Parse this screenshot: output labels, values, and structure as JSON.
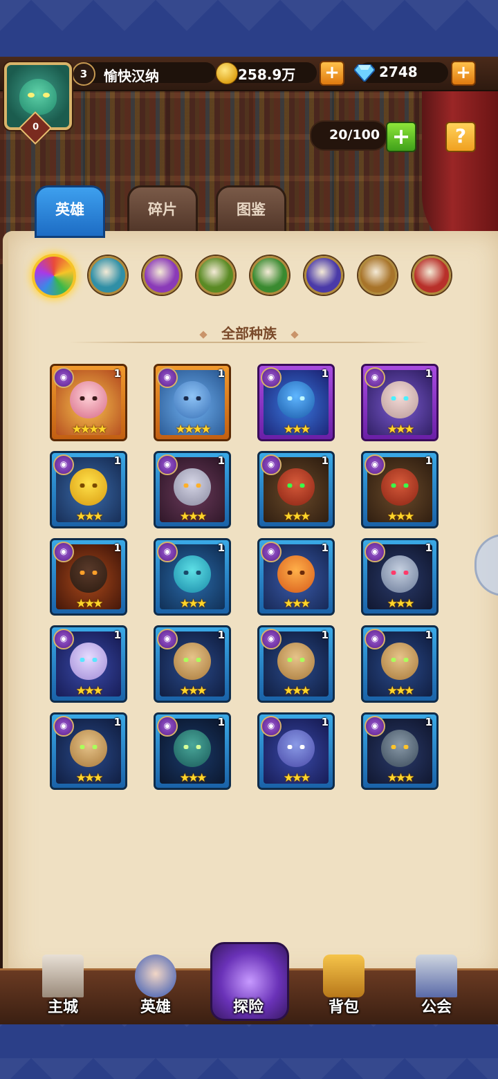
{
  "header": {
    "player_level": "3",
    "player_name": "愉快汉纳",
    "vip_level": "0",
    "gold": "258.9万",
    "gems": "2748",
    "add_label": "+"
  },
  "roster": {
    "capacity": "20/100",
    "add_label": "+",
    "help_label": "?"
  },
  "tabs": [
    {
      "label": "英雄",
      "active": true
    },
    {
      "label": "碎片",
      "active": false
    },
    {
      "label": "图鉴",
      "active": false
    }
  ],
  "filters": [
    {
      "name": "all-factions-filter",
      "active": true,
      "color": "#e95b3a"
    },
    {
      "name": "forest-filter",
      "active": false,
      "color": "#2f8fa6"
    },
    {
      "name": "abyss-filter",
      "active": false,
      "color": "#8a3ab8"
    },
    {
      "name": "fortress-filter",
      "active": false,
      "color": "#5a8a24"
    },
    {
      "name": "nature-filter",
      "active": false,
      "color": "#3a8a30"
    },
    {
      "name": "shadow-filter",
      "active": false,
      "color": "#4a3aa8"
    },
    {
      "name": "light-filter",
      "active": false,
      "color": "#a8742a"
    },
    {
      "name": "dark-filter",
      "active": false,
      "color": "#b8302a"
    }
  ],
  "section_title": "全部种族",
  "heroes": [
    {
      "level": "1",
      "stars": "★★★★",
      "frame": "orange",
      "c1": "#f7c24e",
      "c2": "#b0441c",
      "h1": "#ffd2d8",
      "h2": "#d66a86",
      "e": "#3a1a1a"
    },
    {
      "level": "1",
      "stars": "★★★★",
      "frame": "orange",
      "c1": "#6fb0f0",
      "c2": "#26548e",
      "h1": "#8fc4f6",
      "h2": "#3a72b8",
      "e": "#1a2a4a"
    },
    {
      "level": "1",
      "stars": "★★★",
      "frame": "purple",
      "c1": "#3a7ae0",
      "c2": "#1a1e6e",
      "h1": "#5fb6ff",
      "h2": "#1a5aa8",
      "e": "#bff8ff"
    },
    {
      "level": "1",
      "stars": "★★★",
      "frame": "purple",
      "c1": "#7a5ad0",
      "c2": "#2a1a5a",
      "h1": "#f4dcd8",
      "h2": "#b89a98",
      "e": "#4af0ff"
    },
    {
      "level": "1",
      "stars": "★★★",
      "frame": "blue",
      "c1": "#3a6aa8",
      "c2": "#14284e",
      "h1": "#ffe14a",
      "h2": "#d89a10",
      "e": "#7a4a00"
    },
    {
      "level": "1",
      "stars": "★★★",
      "frame": "blue",
      "c1": "#6a3a5a",
      "c2": "#2a1424",
      "h1": "#d6d6e6",
      "h2": "#8a8aa0",
      "e": "#ffb02a"
    },
    {
      "level": "1",
      "stars": "★★★",
      "frame": "blue",
      "c1": "#6a4a2a",
      "c2": "#2a1a0e",
      "h1": "#d65a3a",
      "h2": "#8a2414",
      "e": "#3aff4a"
    },
    {
      "level": "1",
      "stars": "★★★",
      "frame": "blue",
      "c1": "#6a4a2a",
      "c2": "#2a1a0e",
      "h1": "#d65a3a",
      "h2": "#8a2414",
      "e": "#3aff4a"
    },
    {
      "level": "1",
      "stars": "★★★",
      "frame": "blue",
      "c1": "#a8481a",
      "c2": "#3a1208",
      "h1": "#5a3a2a",
      "h2": "#2a1a10",
      "e": "#ffa02a"
    },
    {
      "level": "1",
      "stars": "★★★",
      "frame": "blue",
      "c1": "#2a6aa8",
      "c2": "#0e2a4e",
      "h1": "#5ee0e6",
      "h2": "#1a8aa8",
      "e": "#1a4a6a"
    },
    {
      "level": "1",
      "stars": "★★★",
      "frame": "blue",
      "c1": "#3a5aa8",
      "c2": "#14244e",
      "h1": "#ffb04a",
      "h2": "#d65a1a",
      "e": "#6a2a0a"
    },
    {
      "level": "1",
      "stars": "★★★",
      "frame": "blue",
      "c1": "#2a3a6a",
      "c2": "#0e142a",
      "h1": "#c6d0e0",
      "h2": "#6a7a98",
      "e": "#ff3a6a"
    },
    {
      "level": "1",
      "stars": "★★★",
      "frame": "blue",
      "c1": "#3a4aa8",
      "c2": "#14184e",
      "h1": "#e6dcff",
      "h2": "#a08ad6",
      "e": "#5ae6ff"
    },
    {
      "level": "1",
      "stars": "★★★",
      "frame": "blue",
      "c1": "#2a4a8a",
      "c2": "#0e1a3a",
      "h1": "#e6c48a",
      "h2": "#a8783a",
      "e": "#aaff5a"
    },
    {
      "level": "1",
      "stars": "★★★",
      "frame": "blue",
      "c1": "#2a4a8a",
      "c2": "#0e1a3a",
      "h1": "#e6c48a",
      "h2": "#a8783a",
      "e": "#aaff5a"
    },
    {
      "level": "1",
      "stars": "★★★",
      "frame": "blue",
      "c1": "#2a4a8a",
      "c2": "#0e1a3a",
      "h1": "#e6c48a",
      "h2": "#a8783a",
      "e": "#aaff5a"
    },
    {
      "level": "1",
      "stars": "★★★",
      "frame": "blue",
      "c1": "#2a4a8a",
      "c2": "#0e1a3a",
      "h1": "#e6c48a",
      "h2": "#a8783a",
      "e": "#aaff5a"
    },
    {
      "level": "1",
      "stars": "★★★",
      "frame": "blue",
      "c1": "#1a3a6a",
      "c2": "#0a1428",
      "h1": "#4aa89a",
      "h2": "#1a5a5a",
      "e": "#d6ff9a"
    },
    {
      "level": "1",
      "stars": "★★★",
      "frame": "blue",
      "c1": "#3a4aa8",
      "c2": "#14184e",
      "h1": "#8a9ae6",
      "h2": "#4a4aa8",
      "e": "#ffffff"
    },
    {
      "level": "1",
      "stars": "★★★",
      "frame": "blue",
      "c1": "#2a3a6a",
      "c2": "#0e142a",
      "h1": "#8a9aa8",
      "h2": "#3a4a5a",
      "e": "#ffc42a"
    }
  ],
  "bottom_nav": [
    {
      "name": "main-city",
      "label": "主城"
    },
    {
      "name": "heroes",
      "label": "英雄"
    },
    {
      "name": "explore",
      "label": "探险"
    },
    {
      "name": "backpack",
      "label": "背包"
    },
    {
      "name": "guild",
      "label": "公会"
    }
  ]
}
